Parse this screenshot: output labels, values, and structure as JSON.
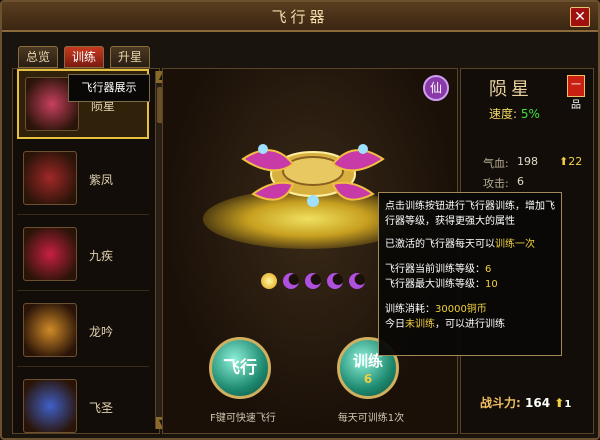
{
  "window": {
    "title": "飞行器",
    "close_label": "✕"
  },
  "tabs": [
    {
      "label": "总览",
      "active": false
    },
    {
      "label": "训练",
      "active": true
    },
    {
      "label": "升星",
      "active": false
    }
  ],
  "list": {
    "items": [
      {
        "name": "陨星",
        "selected": true,
        "color": "#c84060"
      },
      {
        "name": "紫凤",
        "selected": false,
        "color": "#a02828"
      },
      {
        "name": "九疾",
        "selected": false,
        "color": "#c82040"
      },
      {
        "name": "龙吟",
        "selected": false,
        "color": "#d08a28"
      },
      {
        "name": "飞圣",
        "selected": false,
        "color": "#4060c8"
      }
    ],
    "hover_tooltip": "飞行器展示"
  },
  "stage": {
    "fly_button": "飞行",
    "fly_hint": "F键可快速飞行",
    "train_button": "训练",
    "train_count": "6",
    "train_hint": "每天可训练1次",
    "stars": [
      "gold",
      "purple",
      "purple",
      "purple",
      "purple"
    ]
  },
  "info": {
    "badge": "仙",
    "name": "陨星",
    "grade": "一品",
    "speed_label": "速度:",
    "speed_value": "5%",
    "stats": [
      {
        "label": "气血:",
        "value": "198"
      },
      {
        "label": "攻击:",
        "value": "6"
      }
    ],
    "hp_up": "22",
    "power_label": "战斗力:",
    "power_value": "164",
    "power_up": "1"
  },
  "train_tooltip": {
    "line1": "点击训练按钮进行飞行器训练，增加飞行器等级，获得更强大的属性",
    "line2_pre": "已激活的飞行器每天可以",
    "line2_hl": "训练一次",
    "cur_label": "飞行器当前训练等级：",
    "cur_value": "6",
    "max_label": "飞行器最大训练等级：",
    "max_value": "10",
    "cost_label": "训练消耗：",
    "cost_value": "30000铜币",
    "today_pre": "今日",
    "today_hl": "未训练",
    "today_post": "，可以进行训练"
  }
}
